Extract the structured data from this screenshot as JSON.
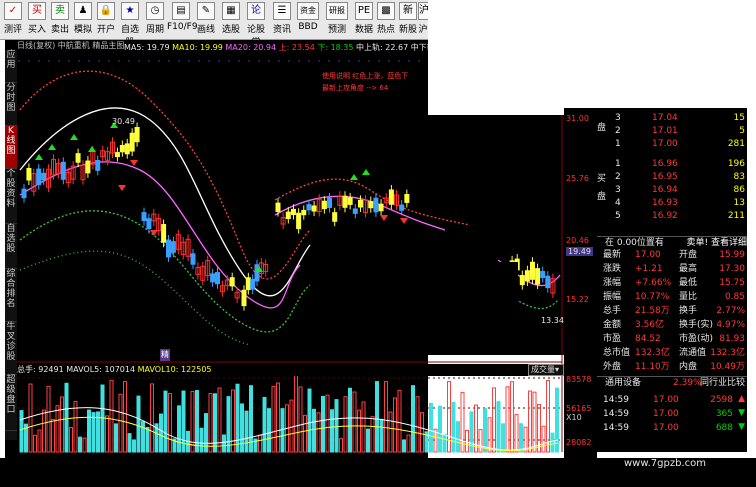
{
  "toolbar": {
    "buttons": [
      "测评",
      "买入",
      "卖出",
      "模拟",
      "开户",
      "自选股",
      "周期",
      "F10/F9",
      "画线",
      "选股",
      "论股堂",
      "资讯",
      "BBD",
      "预测",
      "数据",
      "热点",
      "新股",
      "沪"
    ],
    "mini": [
      "资金",
      "研报"
    ]
  },
  "sidetabs": [
    "应用",
    "分时图",
    "K线图",
    "个股资料",
    "自选股",
    "综合排名",
    "牛叉诊股",
    "超级盘口"
  ],
  "header": {
    "name": "日线(复权)  中航重机  精品主图",
    "ma5": "MA5: 19.79",
    "ma10": "MA10: 19.99",
    "ma20": "MA20: 20.94",
    "up": "上: 23.54",
    "down": "下: 18.35",
    "mid": "中上轨: 22.67",
    "mid2": "中下轨"
  },
  "annotation": {
    "line1": "使用说明 红色上涨，蓝色下",
    "line2": "最新上攻角度 --> 64"
  },
  "chart_labels": {
    "high": "30.49",
    "low": "13.34",
    "tag": "精"
  },
  "axis": [
    "31.00",
    "25.76",
    "20.46",
    "19.49",
    "15.22"
  ],
  "vol": {
    "total": "总手: 92491",
    "mavol5": "MAVOL5: 107014",
    "mavol10": "MAVOL10: 122505",
    "menu": "成交量",
    "axis": [
      "83578",
      "56165",
      "X10",
      "28082"
    ]
  },
  "orderbook": {
    "sell": [
      {
        "level": "3",
        "price": "17.04",
        "vol": "15"
      },
      {
        "level": "2",
        "price": "17.01",
        "vol": "5"
      },
      {
        "level": "1",
        "price": "17.00",
        "vol": "281"
      }
    ],
    "buy": [
      {
        "level": "1",
        "price": "16.96",
        "vol": "196"
      },
      {
        "level": "2",
        "price": "16.95",
        "vol": "83"
      },
      {
        "level": "3",
        "price": "16.94",
        "vol": "86"
      },
      {
        "level": "4",
        "price": "16.93",
        "vol": "13"
      },
      {
        "level": "5",
        "price": "16.92",
        "vol": "211"
      }
    ],
    "sell_label": "盘",
    "buy_label": "买盘"
  },
  "position": {
    "left": "在 0.00位置有",
    "right": "卖单! 查看详细"
  },
  "quote": [
    {
      "k1": "最新",
      "v1": "17.00",
      "k2": "开盘",
      "v2": "15.99"
    },
    {
      "k1": "涨跌",
      "v1": "+1.21",
      "k2": "最高",
      "v2": "17.30"
    },
    {
      "k1": "涨幅",
      "v1": "+7.66%",
      "k2": "最低",
      "v2": "15.75"
    },
    {
      "k1": "振幅",
      "v1": "10.77%",
      "k2": "量比",
      "v2": "0.85"
    },
    {
      "k1": "总手",
      "v1": "21.58万",
      "k2": "换手",
      "v2": "2.77%"
    },
    {
      "k1": "金额",
      "v1": "3.56亿",
      "k2": "换手(实)",
      "v2": "4.97%"
    },
    {
      "k1": "市盈",
      "v1": "84.52",
      "k2": "市盈(动)",
      "v2": "81.93"
    },
    {
      "k1": "总市值",
      "v1": "132.3亿",
      "k2": "流通值",
      "v2": "132.3亿"
    },
    {
      "k1": "外盘",
      "v1": "11.10万",
      "k2": "内盘",
      "v2": "10.49万"
    }
  ],
  "industry": {
    "name": "通用设备",
    "pct": "2.39%",
    "link": "同行业比较"
  },
  "ticks": [
    {
      "time": "14:59",
      "price": "17.00",
      "vol": "2598"
    },
    {
      "time": "14:59",
      "price": "17.00",
      "vol": "365"
    },
    {
      "time": "14:59",
      "price": "17.00",
      "vol": "688"
    }
  ],
  "watermark": "www.7gpzb.com"
}
